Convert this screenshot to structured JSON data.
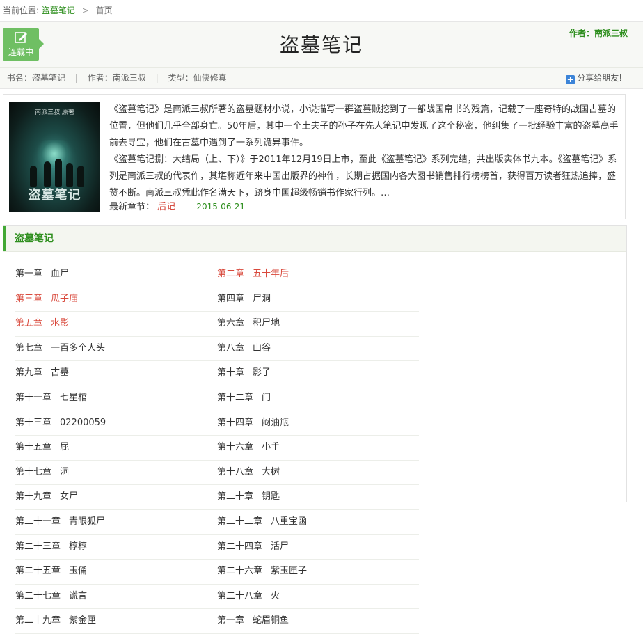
{
  "breadcrumb": {
    "prefix": "当前位置:",
    "book_link": "盗墓笔记",
    "separator": ">",
    "current": "首页"
  },
  "header": {
    "status_label": "连载中",
    "title": "盗墓笔记",
    "author_label": "作者：南派三叔"
  },
  "meta": {
    "book_name": "书名：盗墓笔记",
    "author": "作者：南派三叔",
    "category": "类型：仙侠修真",
    "divider": "|",
    "share_label": "分享给朋友!"
  },
  "intro": {
    "cover_top_text": "南派三叔 原著",
    "cover_title": "盗墓笔记",
    "paragraph_1": "《盗墓笔记》是南派三叔所著的盗墓题材小说，小说描写一群盗墓贼挖到了一部战国帛书的残篇，记载了一座奇特的战国古墓的位置，但他们几乎全部身亡。50年后，其中一个土夫子的孙子在先人笔记中发现了这个秘密，他纠集了一批经验丰富的盗墓高手前去寻宝，他们在古墓中遇到了一系列诡异事件。",
    "paragraph_2": "《盗墓笔记捌：大结局（上、下）》于2011年12月19日上市，至此《盗墓笔记》系列完结，共出版实体书九本。《盗墓笔记》系列是南派三叔的代表作，其堪称近年来中国出版界的神作，长期占据国内各大图书销售排行榜榜首，获得百万读者狂热追捧，盛赞不断。南派三叔凭此作名满天下，跻身中国超级畅销书作家行列。…",
    "latest_label": "最新章节：",
    "latest_chapter": "后记",
    "latest_date": "2015-06-21"
  },
  "chapter_list": {
    "heading": "盗墓笔记",
    "chapters": [
      {
        "num": "第一章",
        "name": "血尸",
        "read": false
      },
      {
        "num": "第二章",
        "name": "五十年后",
        "read": true
      },
      {
        "num": "第三章",
        "name": "瓜子庙",
        "read": true
      },
      {
        "num": "第四章",
        "name": "尸洞",
        "read": false
      },
      {
        "num": "第五章",
        "name": "水影",
        "read": true
      },
      {
        "num": "第六章",
        "name": "积尸地",
        "read": false
      },
      {
        "num": "第七章",
        "name": "一百多个人头",
        "read": false
      },
      {
        "num": "第八章",
        "name": "山谷",
        "read": false
      },
      {
        "num": "第九章",
        "name": "古墓",
        "read": false
      },
      {
        "num": "第十章",
        "name": "影子",
        "read": false
      },
      {
        "num": "第十一章",
        "name": "七星棺",
        "read": false
      },
      {
        "num": "第十二章",
        "name": "门",
        "read": false
      },
      {
        "num": "第十三章",
        "name": "02200059",
        "read": false
      },
      {
        "num": "第十四章",
        "name": "闷油瓶",
        "read": false
      },
      {
        "num": "第十五章",
        "name": "屁",
        "read": false
      },
      {
        "num": "第十六章",
        "name": "小手",
        "read": false
      },
      {
        "num": "第十七章",
        "name": "洞",
        "read": false
      },
      {
        "num": "第十八章",
        "name": "大树",
        "read": false
      },
      {
        "num": "第十九章",
        "name": "女尸",
        "read": false
      },
      {
        "num": "第二十章",
        "name": "钥匙",
        "read": false
      },
      {
        "num": "第二十一章",
        "name": "青眼狐尸",
        "read": false
      },
      {
        "num": "第二十二章",
        "name": "八重宝函",
        "read": false
      },
      {
        "num": "第二十三章",
        "name": "椁椁",
        "read": false
      },
      {
        "num": "第二十四章",
        "name": "活尸",
        "read": false
      },
      {
        "num": "第二十五章",
        "name": "玉俑",
        "read": false
      },
      {
        "num": "第二十六章",
        "name": "紫玉匣子",
        "read": false
      },
      {
        "num": "第二十七章",
        "name": "谎言",
        "read": false
      },
      {
        "num": "第二十八章",
        "name": "火",
        "read": false
      },
      {
        "num": "第二十九章",
        "name": "紫金匣",
        "read": false
      },
      {
        "num": "第一章",
        "name": "蛇眉铜鱼",
        "read": false
      }
    ]
  },
  "colors": {
    "accent_green": "#2f8f1f",
    "badge_green": "#6fbf63",
    "visited_red": "#d9493c",
    "share_blue": "#3c84d8"
  }
}
